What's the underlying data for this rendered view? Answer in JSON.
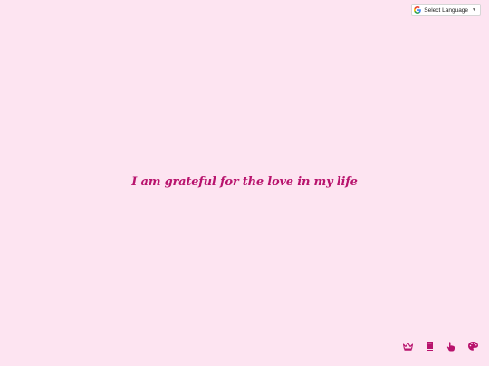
{
  "language_widget": {
    "label": "Select Language",
    "caret": "▼",
    "icon": "google-g-icon"
  },
  "affirmation": {
    "text": "I am grateful for the love in my life"
  },
  "toolbar": {
    "icons": [
      "crown-icon",
      "book-icon",
      "hand-pointer-icon",
      "palette-icon"
    ]
  },
  "colors": {
    "background": "#fde4f1",
    "text": "#b8136d",
    "icons": "#b8136d"
  }
}
